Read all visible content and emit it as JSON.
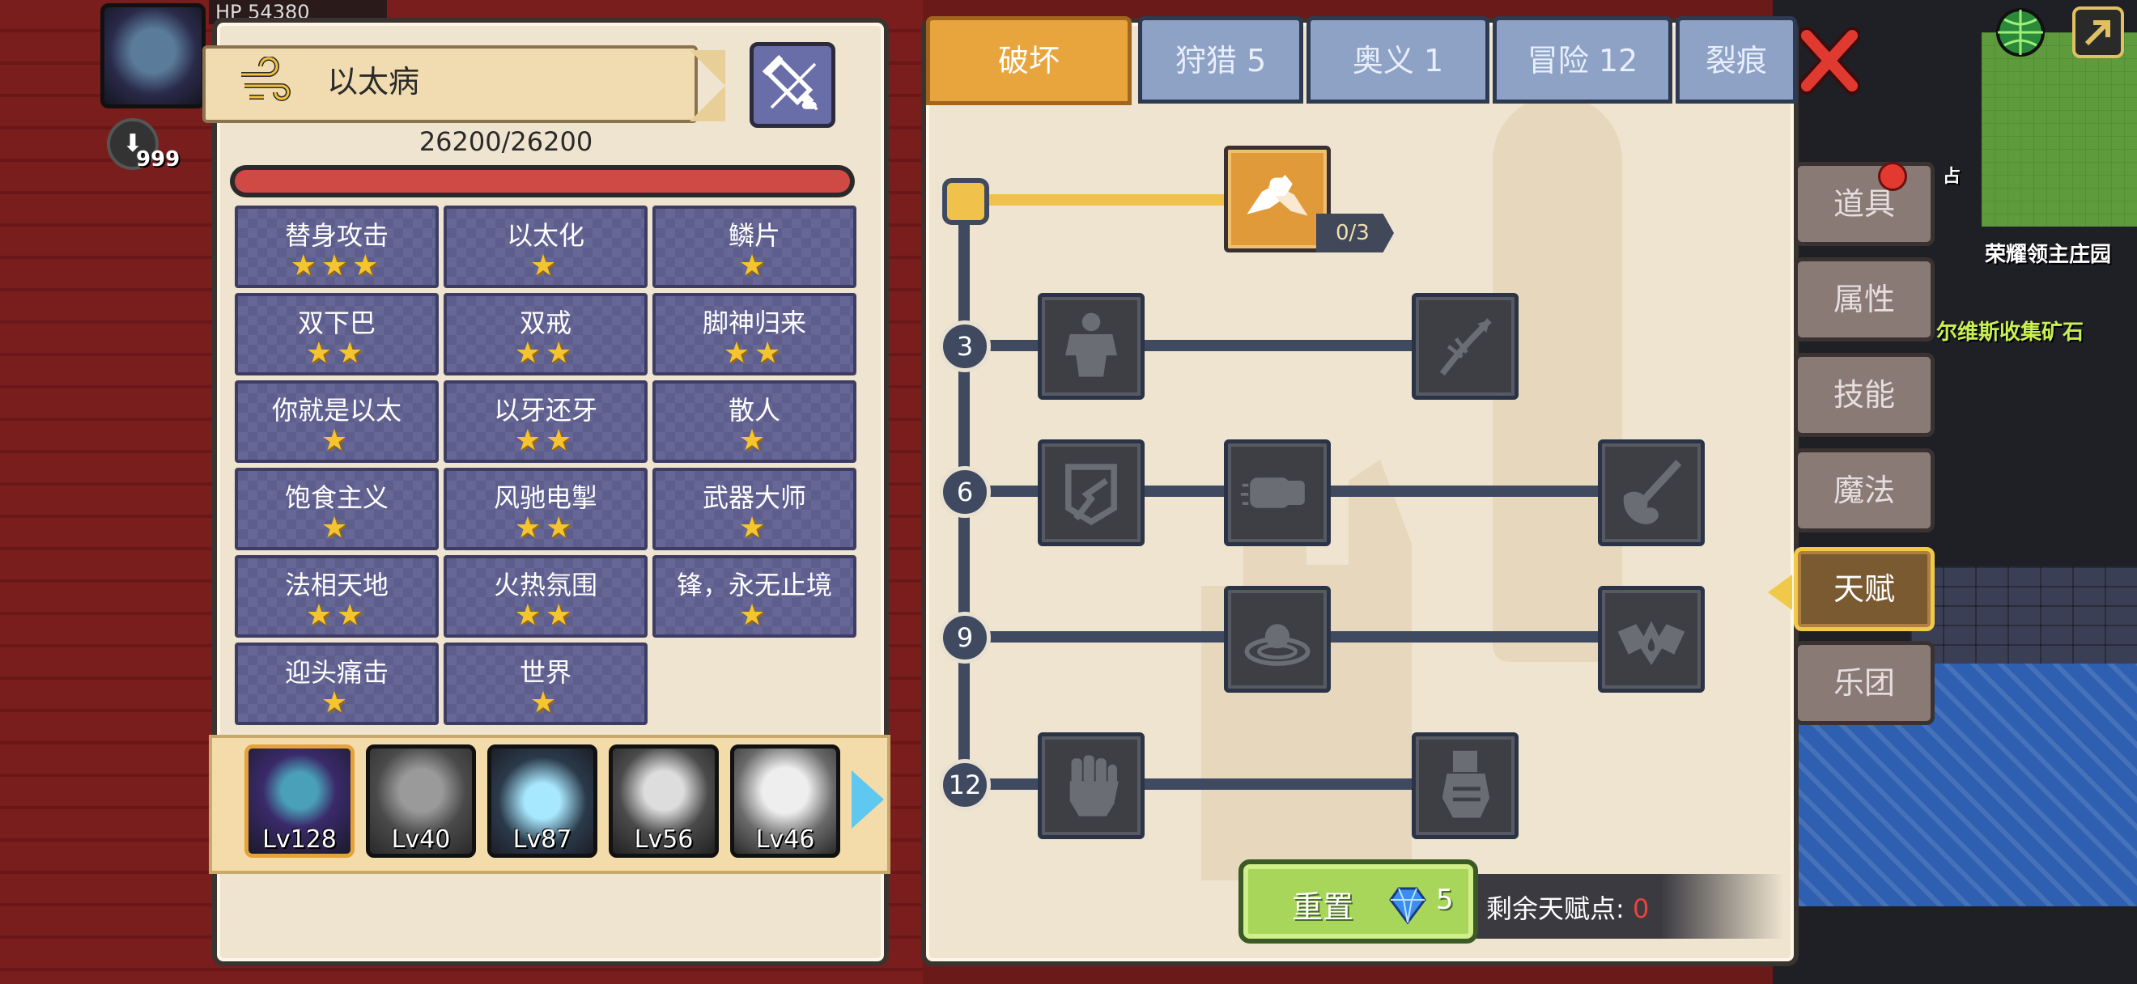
{
  "player": {
    "hp_label": "HP 54380",
    "badge_count": "999"
  },
  "character": {
    "name": "以太病",
    "hp": "26200/26200",
    "hp_fraction": 1.0,
    "traits": [
      {
        "name": "替身攻击",
        "stars": 3
      },
      {
        "name": "以太化",
        "stars": 1
      },
      {
        "name": "鳞片",
        "stars": 1
      },
      {
        "name": "双下巴",
        "stars": 2
      },
      {
        "name": "双戒",
        "stars": 2
      },
      {
        "name": "脚神归来",
        "stars": 2
      },
      {
        "name": "你就是以太",
        "stars": 1
      },
      {
        "name": "以牙还牙",
        "stars": 2
      },
      {
        "name": "散人",
        "stars": 1
      },
      {
        "name": "饱食主义",
        "stars": 1
      },
      {
        "name": "风驰电掣",
        "stars": 2
      },
      {
        "name": "武器大师",
        "stars": 1
      },
      {
        "name": "法相天地",
        "stars": 2
      },
      {
        "name": "火热氛围",
        "stars": 2
      },
      {
        "name": "锋，永无止境",
        "stars": 1
      },
      {
        "name": "迎头痛击",
        "stars": 1
      },
      {
        "name": "世界",
        "stars": 1
      }
    ],
    "roster": [
      {
        "level": "Lv128",
        "selected": true
      },
      {
        "level": "Lv40",
        "selected": false
      },
      {
        "level": "Lv87",
        "selected": false
      },
      {
        "level": "Lv56",
        "selected": false
      },
      {
        "level": "Lv46",
        "selected": false
      }
    ]
  },
  "talent": {
    "tabs": [
      "破坏",
      "狩猎 5",
      "奥义 1",
      "冒险 12",
      "裂痕"
    ],
    "active_tab": "破坏",
    "top_node_counter": "0/3",
    "tiers": [
      "3",
      "6",
      "9",
      "12"
    ],
    "node_icons": {
      "top": "arm-wrestle-icon",
      "tier3": [
        "muscle-body-icon",
        "arrow-strike-icon"
      ],
      "tier6": [
        "shield-break-icon",
        "punch-icon",
        "splash-strike-icon"
      ],
      "tier9": [
        "ripple-orb-icon",
        "bat-drop-icon"
      ],
      "tier12": [
        "raised-fist-icon",
        "gauntlet-icon"
      ]
    },
    "reset_label": "重置",
    "reset_cost": "5",
    "points_label": "剩余天赋点:",
    "points_value": "0"
  },
  "side_menu": [
    "道具",
    "属性",
    "技能",
    "魔法",
    "天赋",
    "乐团"
  ],
  "side_menu_active": "天赋",
  "map_labels": {
    "manor": "荣耀领主庄园",
    "quest": "尔维斯收集矿石",
    "small": "占"
  },
  "colors": {
    "active_tab": "#e8a53d",
    "star": "#f5c531",
    "hp_bar": "#cf4a44",
    "reset_button": "#a8d65a",
    "points_value": "#e8443a"
  }
}
